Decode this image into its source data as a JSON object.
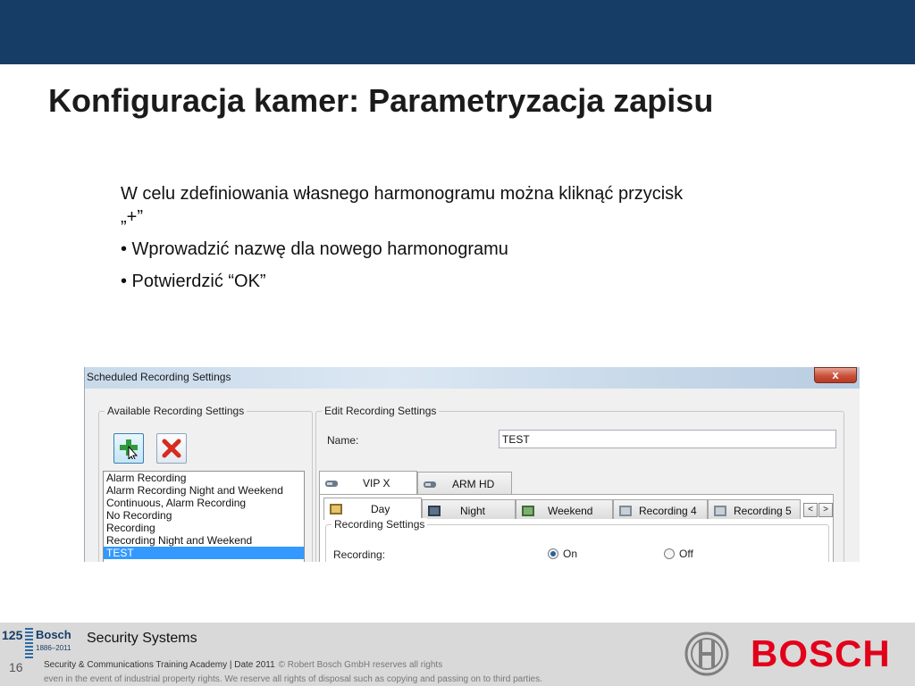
{
  "slide": {
    "title": "Konfiguracja kamer: Parametryzacja zapisu",
    "intro": "W celu zdefiniowania własnego harmonogramu można kliknąć przycisk „+”",
    "bullets": [
      "• Wprowadzić nazwę dla nowego harmonogramu",
      "• Potwierdzić “OK”"
    ]
  },
  "dialog": {
    "title": "Scheduled Recording Settings",
    "close_glyph": "x",
    "available": {
      "legend": "Available Recording Settings",
      "add_icon": "add-plus-icon",
      "delete_icon": "delete-x-icon",
      "items": [
        "Alarm Recording",
        "Alarm Recording Night and Weekend",
        "Continuous, Alarm Recording",
        "No Recording",
        "Recording",
        "Recording Night and Weekend",
        "TEST"
      ],
      "selected_index": 6
    },
    "edit": {
      "legend": "Edit Recording Settings",
      "name_label": "Name:",
      "name_value": "TEST",
      "camera_tabs": [
        "VIP X",
        "ARM HD"
      ],
      "active_camera_tab": 0,
      "schedule_tabs": [
        "Day",
        "Night",
        "Weekend",
        "Recording 4",
        "Recording 5"
      ],
      "active_schedule_tab": 0,
      "scroll_left": "<",
      "scroll_right": ">",
      "recording_settings": {
        "legend": "Recording Settings",
        "recording_label": "Recording:",
        "on_label": "On",
        "off_label": "Off",
        "selected": "On"
      }
    }
  },
  "footer": {
    "logo_number": "125",
    "logo_brand": "Bosch",
    "logo_years": "1886–2011",
    "section": "Security Systems",
    "page_number": "16",
    "legal_line1": "Security & Communications Training Academy | Date 2011",
    "legal_copyright": "© Robert Bosch GmbH reserves all rights",
    "legal_line2": "even in the event of industrial property rights. We reserve all rights of disposal such as copying and passing on to third parties.",
    "brand": "BOSCH"
  },
  "colors": {
    "header_band": "#163d66",
    "selection": "#3399ff",
    "bosch_red": "#e2001a"
  }
}
